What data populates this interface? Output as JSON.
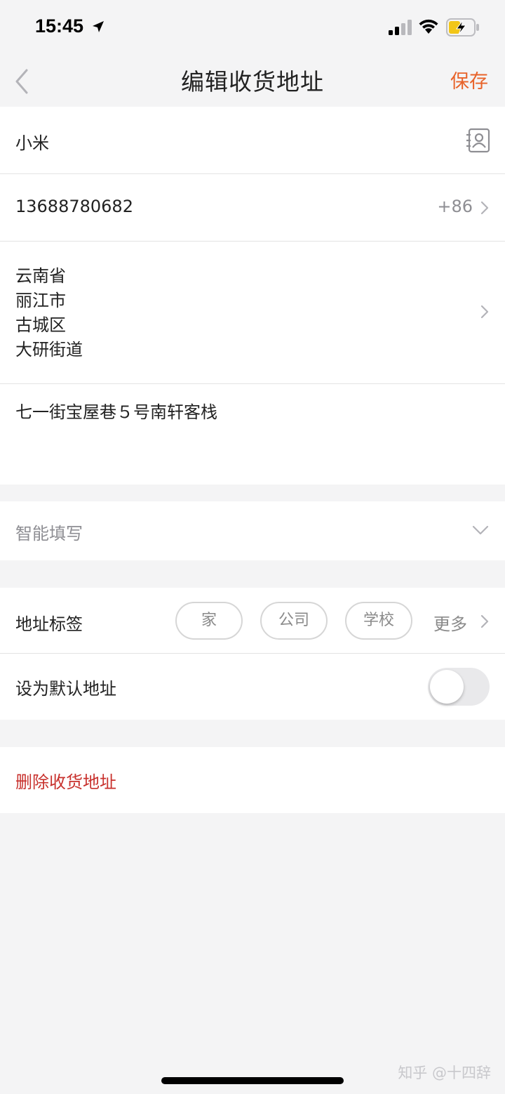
{
  "status_bar": {
    "time": "15:45"
  },
  "nav": {
    "title": "编辑收货地址",
    "save_label": "保存"
  },
  "form": {
    "name": "小米",
    "phone": "13688780682",
    "country_code": "+86",
    "region": [
      "云南省",
      "丽江市",
      "古城区",
      "大研街道"
    ],
    "detail_address": "七一街宝屋巷５号南轩客栈"
  },
  "smart_fill": {
    "label": "智能填写"
  },
  "address_tag": {
    "label": "地址标签",
    "options": [
      "家",
      "公司",
      "学校"
    ],
    "more_label": "更多"
  },
  "default_address": {
    "label": "设为默认地址",
    "enabled": false
  },
  "delete": {
    "label": "删除收货地址"
  },
  "watermark": "知乎 @十四辞",
  "colors": {
    "accent": "#e8632a",
    "danger": "#c8312d",
    "background": "#f4f4f5"
  },
  "icons": [
    "location-arrow-icon",
    "signal-icon",
    "wifi-icon",
    "battery-charging-icon",
    "back-chevron-icon",
    "contact-book-icon",
    "chevron-right-icon",
    "chevron-down-icon"
  ]
}
